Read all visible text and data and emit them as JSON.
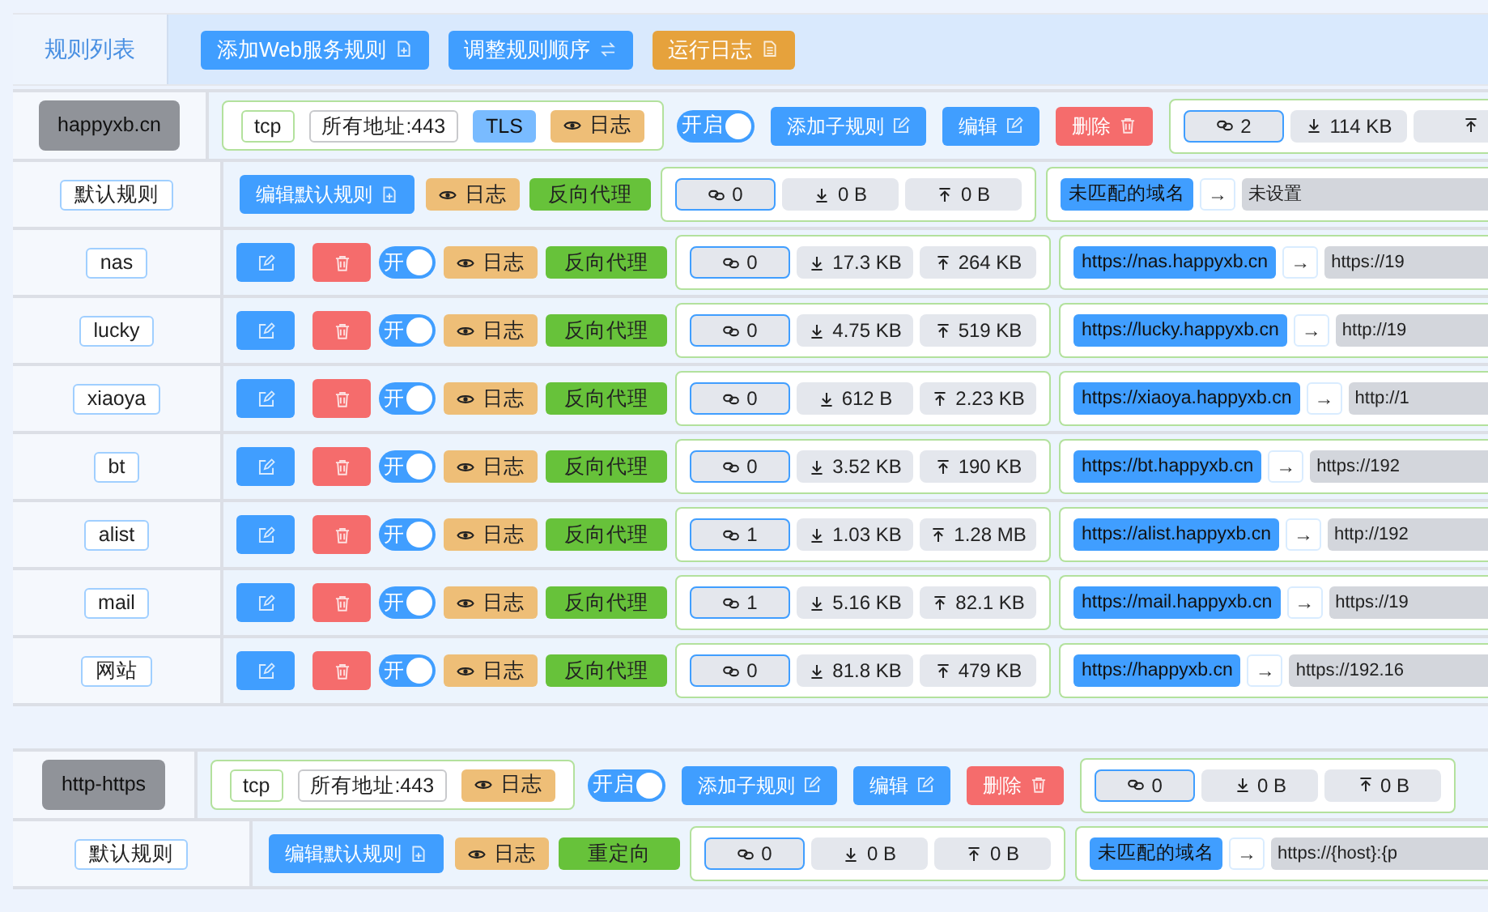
{
  "tabs": [
    {
      "label": "规则列表",
      "selected": true
    }
  ],
  "toolbar": [
    {
      "label": "添加Web服务规则",
      "kind": "primary"
    },
    {
      "label": "调整规则顺序",
      "kind": "primary"
    },
    {
      "label": "运行日志",
      "kind": "warning"
    }
  ],
  "groups": [
    {
      "name": "happyxb.cn",
      "listener": {
        "protocol": "tcp",
        "address": "所有地址:443",
        "tls": "TLS",
        "log": "日志"
      },
      "switch": {
        "label": "开启",
        "on": true
      },
      "buttons": [
        {
          "label": "添加子规则",
          "kind": "primary"
        },
        {
          "label": "编辑",
          "kind": "primary"
        },
        {
          "label": "删除",
          "kind": "danger"
        }
      ],
      "stats": {
        "connections": "2",
        "download": "114 KB"
      },
      "default_rule": {
        "label": "默认规则",
        "edit_button": "编辑默认规则",
        "log": "日志",
        "type": "反向代理",
        "stats": {
          "connections": "0",
          "download": "0 B",
          "upload": "0 B"
        },
        "from": "未匹配的域名",
        "arrow": "→",
        "to": "未设置"
      },
      "rules": [
        {
          "name": "nas",
          "switch": {
            "label": "开",
            "on": true
          },
          "log": "日志",
          "type": "反向代理",
          "stats": {
            "connections": "0",
            "download": "17.3 KB",
            "upload": "264 KB"
          },
          "from": "https://nas.happyxb.cn",
          "arrow": "→",
          "to": "https://19"
        },
        {
          "name": "lucky",
          "switch": {
            "label": "开",
            "on": true
          },
          "log": "日志",
          "type": "反向代理",
          "stats": {
            "connections": "0",
            "download": "4.75 KB",
            "upload": "519 KB"
          },
          "from": "https://lucky.happyxb.cn",
          "arrow": "→",
          "to": "http://19"
        },
        {
          "name": "xiaoya",
          "switch": {
            "label": "开",
            "on": true
          },
          "log": "日志",
          "type": "反向代理",
          "stats": {
            "connections": "0",
            "download": "612 B",
            "upload": "2.23 KB"
          },
          "from": "https://xiaoya.happyxb.cn",
          "arrow": "→",
          "to": "http://1"
        },
        {
          "name": "bt",
          "switch": {
            "label": "开",
            "on": true
          },
          "log": "日志",
          "type": "反向代理",
          "stats": {
            "connections": "0",
            "download": "3.52 KB",
            "upload": "190 KB"
          },
          "from": "https://bt.happyxb.cn",
          "arrow": "→",
          "to": "https://192"
        },
        {
          "name": "alist",
          "switch": {
            "label": "开",
            "on": true
          },
          "log": "日志",
          "type": "反向代理",
          "stats": {
            "connections": "1",
            "download": "1.03 KB",
            "upload": "1.28 MB"
          },
          "from": "https://alist.happyxb.cn",
          "arrow": "→",
          "to": "http://192"
        },
        {
          "name": "mail",
          "switch": {
            "label": "开",
            "on": true
          },
          "log": "日志",
          "type": "反向代理",
          "stats": {
            "connections": "1",
            "download": "5.16 KB",
            "upload": "82.1 KB"
          },
          "from": "https://mail.happyxb.cn",
          "arrow": "→",
          "to": "https://19"
        },
        {
          "name": "网站",
          "switch": {
            "label": "开",
            "on": true
          },
          "log": "日志",
          "type": "反向代理",
          "stats": {
            "connections": "0",
            "download": "81.8 KB",
            "upload": "479 KB"
          },
          "from": "https://happyxb.cn",
          "arrow": "→",
          "to": "https://192.16"
        }
      ]
    },
    {
      "name": "http-https",
      "listener": {
        "protocol": "tcp",
        "address": "所有地址:443",
        "log": "日志"
      },
      "switch": {
        "label": "开启",
        "on": true
      },
      "buttons": [
        {
          "label": "添加子规则",
          "kind": "primary"
        },
        {
          "label": "编辑",
          "kind": "primary"
        },
        {
          "label": "删除",
          "kind": "danger"
        }
      ],
      "stats": {
        "connections": "0",
        "download": "0 B",
        "upload": "0 B"
      },
      "default_rule": {
        "label": "默认规则",
        "edit_button": "编辑默认规则",
        "log": "日志",
        "type": "重定向",
        "stats": {
          "connections": "0",
          "download": "0 B",
          "upload": "0 B"
        },
        "from": "未匹配的域名",
        "arrow": "→",
        "to": "https://{host}:{p"
      }
    }
  ]
}
